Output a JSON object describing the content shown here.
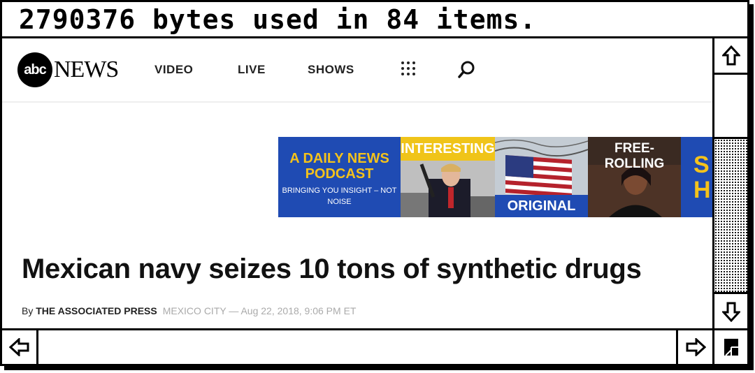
{
  "window": {
    "title": "2790376 bytes used in 84 items."
  },
  "nav": {
    "logo_abc": "abc",
    "logo_news": "NEWS",
    "items": [
      "VIDEO",
      "LIVE",
      "SHOWS"
    ],
    "icons": [
      "grid-icon",
      "search-icon"
    ]
  },
  "banner": {
    "podcast_title": "A DAILY NEWS PODCAST",
    "podcast_tagline": "BRINGING YOU INSIGHT – NOT NOISE",
    "tile2_label": "INTERESTING",
    "tile3_label": "ORIGINAL",
    "tile4_label": "FREE-ROLLING",
    "tile5_label": "S H"
  },
  "article": {
    "headline": "Mexican navy seizes 10 tons of synthetic drugs",
    "by": "By ",
    "author": "THE ASSOCIATED PRESS",
    "meta": "MEXICO CITY — Aug 22, 2018, 9:06 PM ET"
  },
  "scrollbars": {
    "icons": [
      "scroll-up-arrow-icon",
      "scroll-down-arrow-icon",
      "scroll-left-arrow-icon",
      "scroll-right-arrow-icon",
      "grow-box-icon"
    ]
  }
}
